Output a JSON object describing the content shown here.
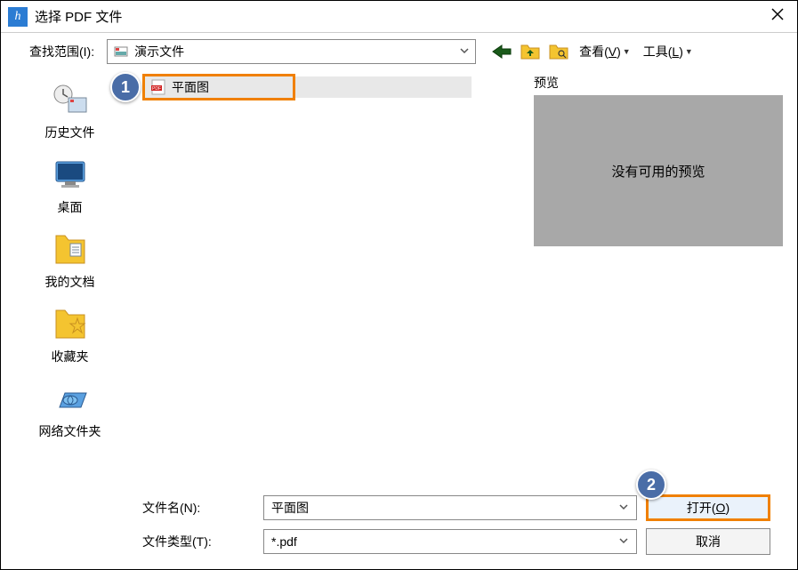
{
  "title": "选择 PDF 文件",
  "lookin_label": "查找范围(I):",
  "lookin_value": "演示文件",
  "view_menu": "查看(V)",
  "tools_menu": "工具(L)",
  "sidebar": {
    "items": [
      {
        "label": "历史文件"
      },
      {
        "label": "桌面"
      },
      {
        "label": "我的文档"
      },
      {
        "label": "收藏夹"
      },
      {
        "label": "网络文件夹"
      }
    ]
  },
  "file": {
    "name": "平面图"
  },
  "preview_label": "预览",
  "preview_empty": "没有可用的预览",
  "filename_label": "文件名(N):",
  "filename_value": "平面图",
  "filetype_label": "文件类型(T):",
  "filetype_value": "*.pdf",
  "open_label": "打开(O)",
  "cancel_label": "取消",
  "callouts": {
    "one": "1",
    "two": "2"
  }
}
